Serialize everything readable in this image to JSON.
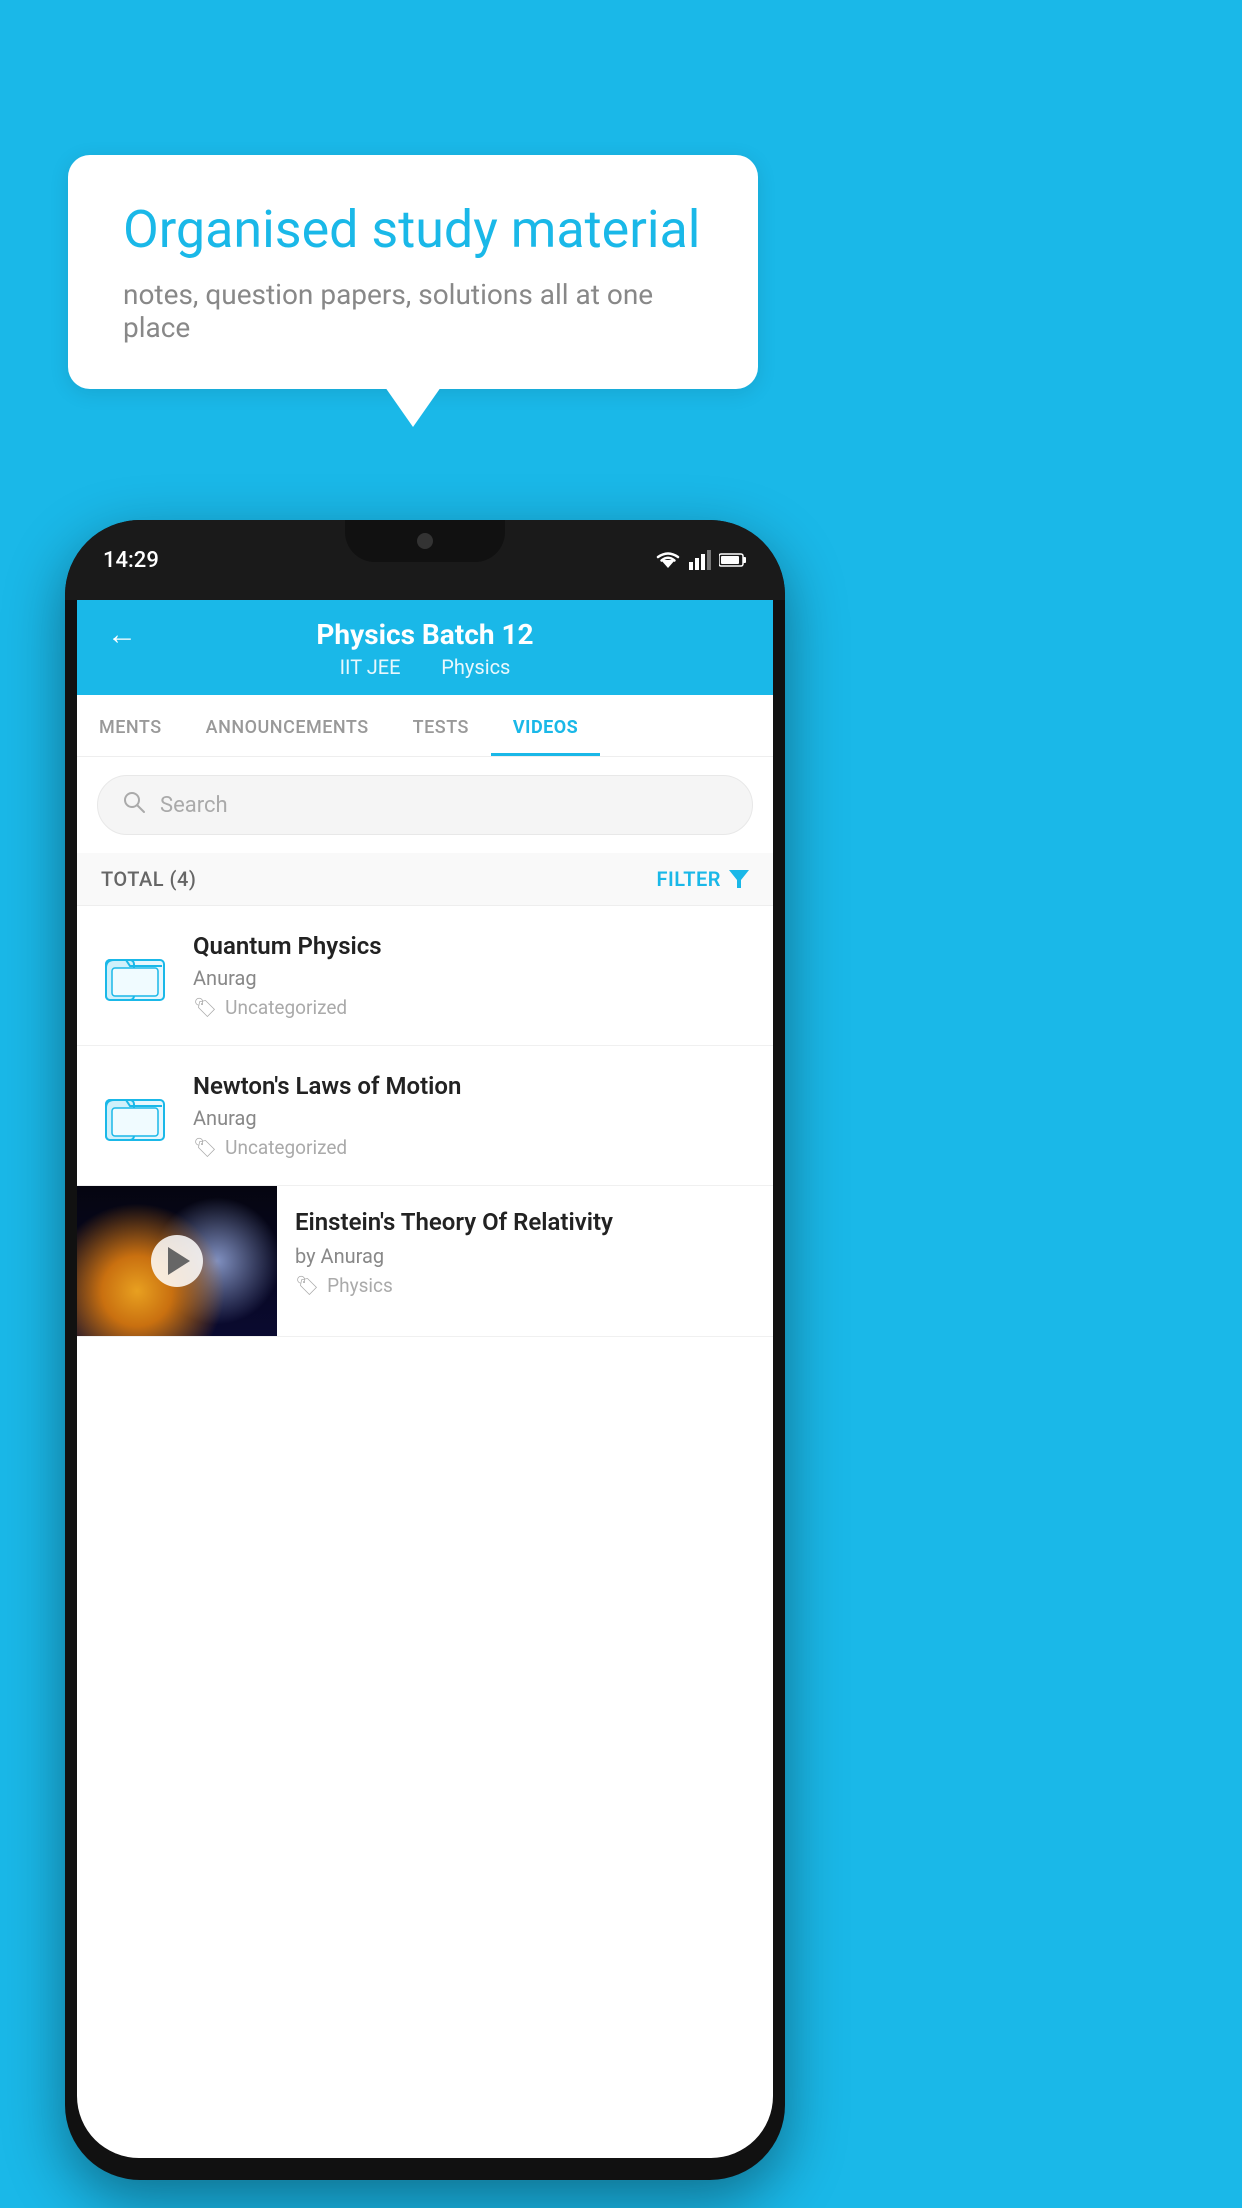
{
  "background_color": "#1ab8e8",
  "speech_bubble": {
    "title": "Organised study material",
    "subtitle": "notes, question papers, solutions all at one place"
  },
  "phone": {
    "status_bar": {
      "time": "14:29"
    },
    "app_header": {
      "title": "Physics Batch 12",
      "subtitle_part1": "IIT JEE",
      "subtitle_part2": "Physics",
      "back_label": "←"
    },
    "tabs": [
      {
        "label": "MENTS",
        "active": false
      },
      {
        "label": "ANNOUNCEMENTS",
        "active": false
      },
      {
        "label": "TESTS",
        "active": false
      },
      {
        "label": "VIDEOS",
        "active": true
      }
    ],
    "search": {
      "placeholder": "Search"
    },
    "filter_bar": {
      "total_label": "TOTAL (4)",
      "filter_label": "FILTER"
    },
    "videos": [
      {
        "id": 1,
        "type": "folder",
        "title": "Quantum Physics",
        "author": "Anurag",
        "tag": "Uncategorized",
        "has_thumbnail": false
      },
      {
        "id": 2,
        "type": "folder",
        "title": "Newton's Laws of Motion",
        "author": "Anurag",
        "tag": "Uncategorized",
        "has_thumbnail": false
      },
      {
        "id": 3,
        "type": "video",
        "title": "Einstein's Theory Of Relativity",
        "author": "by Anurag",
        "tag": "Physics",
        "has_thumbnail": true
      }
    ]
  }
}
